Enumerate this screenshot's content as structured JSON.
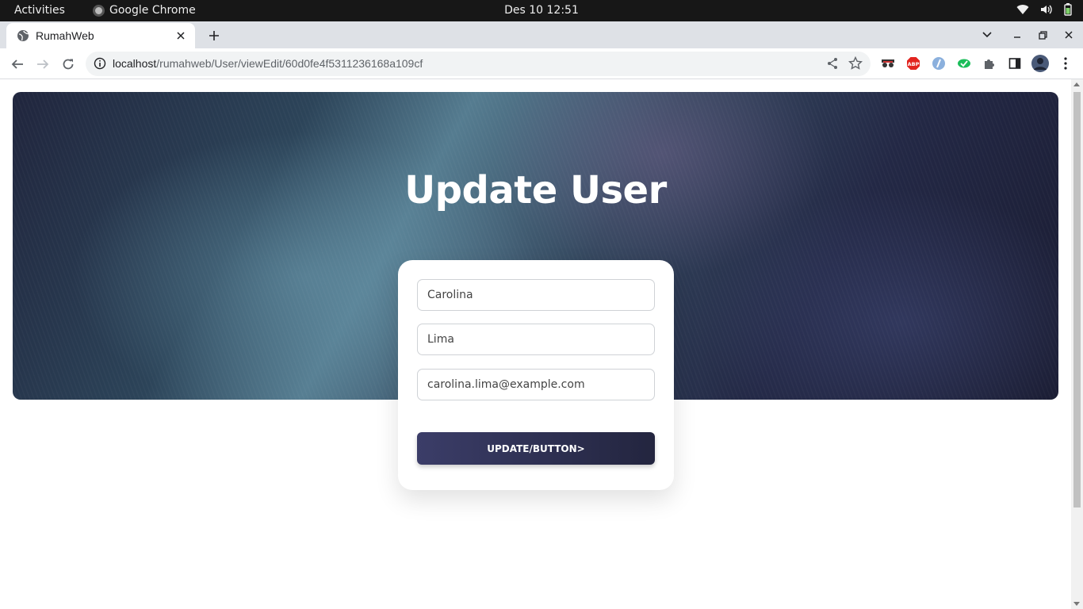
{
  "system_bar": {
    "activities": "Activities",
    "app_name": "Google Chrome",
    "clock": "Des 10  12:51",
    "tray_icons": [
      "wifi-icon",
      "volume-icon",
      "battery-icon"
    ]
  },
  "browser": {
    "tab": {
      "title": "RumahWeb",
      "favicon": "globe-icon"
    },
    "url": {
      "host": "localhost",
      "path": "/rumahweb/User/viewEdit/60d0fe4f5311236168a109cf"
    },
    "extensions": [
      "incognito-mask-icon",
      "adblock-plus-icon",
      "extension-blue-icon",
      "extension-green-icon",
      "puzzle-icon",
      "side-panel-icon",
      "profile-avatar"
    ]
  },
  "page": {
    "heading": "Update User",
    "form": {
      "first_name": "Carolina",
      "last_name": "Lima",
      "email": "carolina.lima@example.com",
      "submit_label": "UPDATE/BUTTON>"
    }
  },
  "colors": {
    "button_start": "#3b3d68",
    "button_end": "#23253f",
    "hero_dark": "#20253d",
    "hero_teal": "#557c90"
  }
}
